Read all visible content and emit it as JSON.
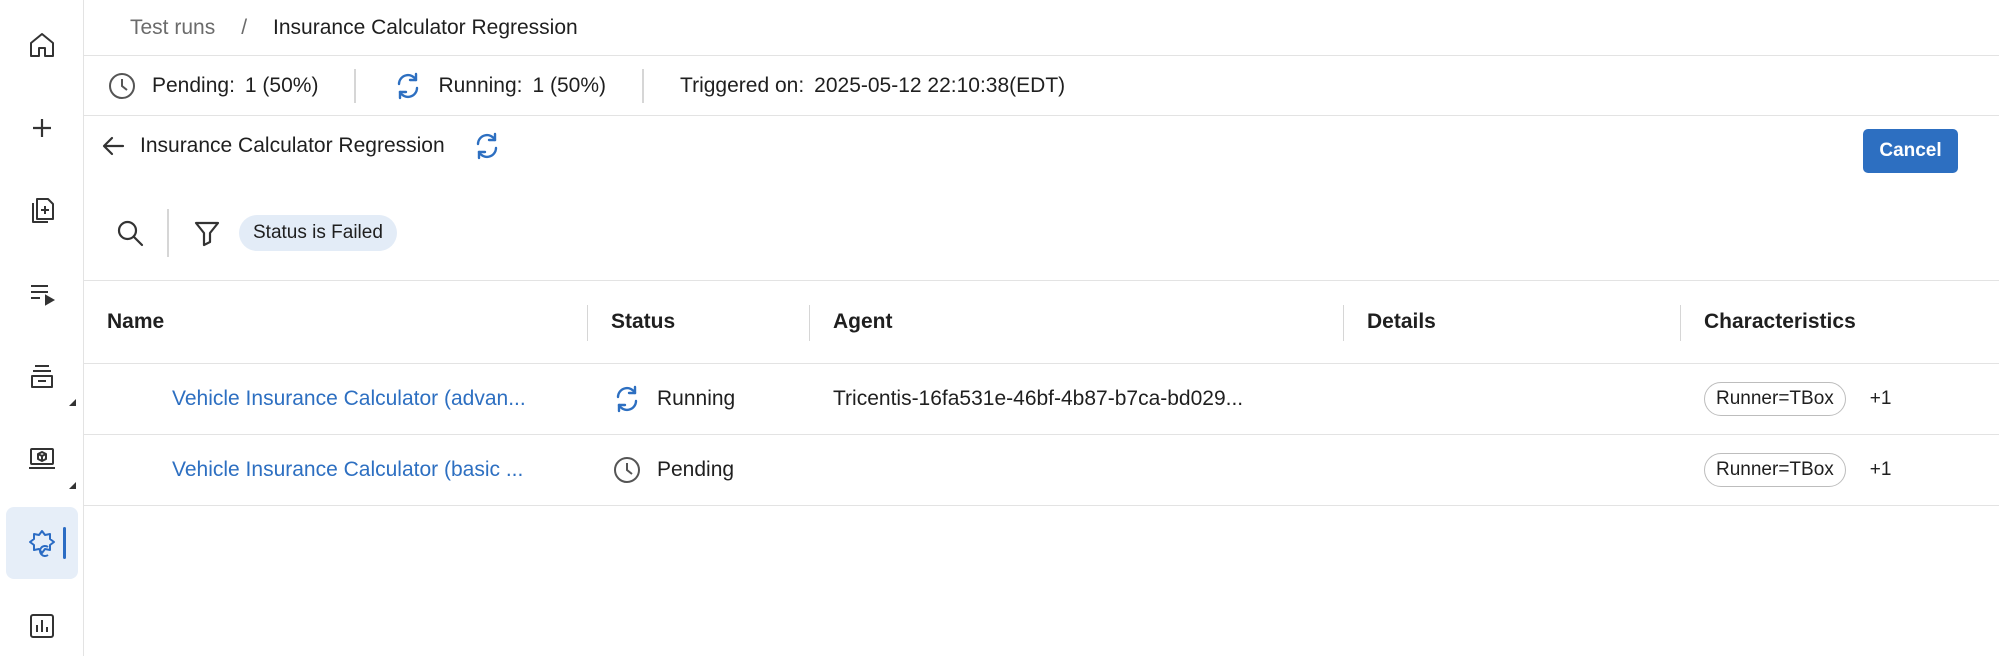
{
  "breadcrumb": {
    "parent": "Test runs",
    "separator": "/",
    "current": "Insurance Calculator Regression"
  },
  "status_bar": {
    "pending_label": "Pending:",
    "pending_value": "1 (50%)",
    "running_label": "Running:",
    "running_value": "1 (50%)",
    "triggered_label": "Triggered on:",
    "triggered_value": "2025-05-12 22:10:38(EDT)"
  },
  "header": {
    "title": "Insurance Calculator Regression",
    "cancel_label": "Cancel"
  },
  "filters": {
    "chip": "Status is Failed"
  },
  "table": {
    "columns": [
      "Name",
      "Status",
      "Agent",
      "Details",
      "Characteristics"
    ],
    "rows": [
      {
        "name": "Vehicle Insurance Calculator (advan...",
        "status": "Running",
        "status_icon": "sync-icon",
        "agent": "Tricentis-16fa531e-46bf-4b87-b7ca-bd029...",
        "details": "",
        "characteristic": "Runner=TBox",
        "more": "+1"
      },
      {
        "name": "Vehicle Insurance Calculator (basic ...",
        "status": "Pending",
        "status_icon": "clock-icon",
        "agent": "",
        "details": "",
        "characteristic": "Runner=TBox",
        "more": "+1"
      }
    ]
  },
  "sidebar": {
    "items": [
      {
        "icon": "home-icon"
      },
      {
        "icon": "plus-icon"
      },
      {
        "icon": "document-add-icon"
      },
      {
        "icon": "playlist-icon"
      },
      {
        "icon": "archive-icon"
      },
      {
        "icon": "agent-monitor-icon"
      },
      {
        "icon": "test-runs-gear-icon",
        "active": true
      },
      {
        "icon": "bar-chart-icon"
      }
    ]
  },
  "colors": {
    "accent": "#2d6fc1",
    "active_bg": "#e6eef8",
    "chip_bg": "#e3ecf7",
    "border": "#e3e3e3"
  }
}
